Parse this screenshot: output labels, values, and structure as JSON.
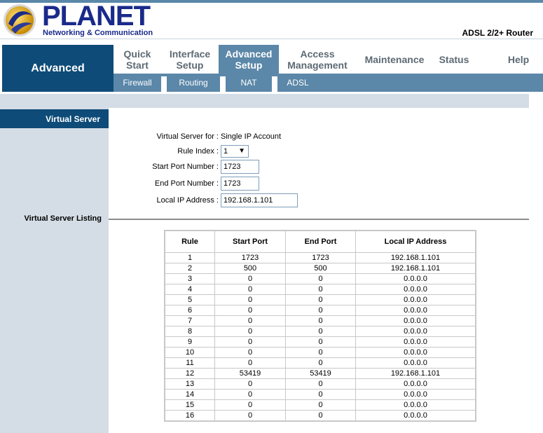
{
  "header": {
    "brand": "PLANET",
    "brand_sub": "Networking & Communication",
    "product": "ADSL 2/2+ Router"
  },
  "section": {
    "title": "Advanced"
  },
  "menu": [
    {
      "line1": "Quick",
      "line2": "Start",
      "active": false
    },
    {
      "line1": "Interface",
      "line2": "Setup",
      "active": false
    },
    {
      "line1": "Advanced",
      "line2": "Setup",
      "active": true
    },
    {
      "line1": "Access",
      "line2": "Management",
      "active": false
    },
    {
      "line1": "Maintenance",
      "line2": "",
      "active": false
    },
    {
      "line1": "Status",
      "line2": "",
      "active": false
    },
    {
      "line1": "Help",
      "line2": "",
      "active": false
    }
  ],
  "submenu": [
    "Firewall",
    "Routing",
    "NAT",
    "ADSL"
  ],
  "left": {
    "virtual_server": "Virtual Server",
    "listing": "Virtual Server Listing"
  },
  "form": {
    "for_label": "Virtual Server for :",
    "for_value": "Single IP Account",
    "rule_index_label": "Rule Index :",
    "rule_index_value": "1",
    "start_port_label": "Start Port Number :",
    "start_port_value": "1723",
    "end_port_label": "End Port Number :",
    "end_port_value": "1723",
    "local_ip_label": "Local IP Address :",
    "local_ip_value": "192.168.1.101"
  },
  "table": {
    "headers": [
      "Rule",
      "Start Port",
      "End Port",
      "Local IP Address"
    ],
    "rows": [
      [
        "1",
        "1723",
        "1723",
        "192.168.1.101"
      ],
      [
        "2",
        "500",
        "500",
        "192.168.1.101"
      ],
      [
        "3",
        "0",
        "0",
        "0.0.0.0"
      ],
      [
        "4",
        "0",
        "0",
        "0.0.0.0"
      ],
      [
        "5",
        "0",
        "0",
        "0.0.0.0"
      ],
      [
        "6",
        "0",
        "0",
        "0.0.0.0"
      ],
      [
        "7",
        "0",
        "0",
        "0.0.0.0"
      ],
      [
        "8",
        "0",
        "0",
        "0.0.0.0"
      ],
      [
        "9",
        "0",
        "0",
        "0.0.0.0"
      ],
      [
        "10",
        "0",
        "0",
        "0.0.0.0"
      ],
      [
        "11",
        "0",
        "0",
        "0.0.0.0"
      ],
      [
        "12",
        "53419",
        "53419",
        "192.168.1.101"
      ],
      [
        "13",
        "0",
        "0",
        "0.0.0.0"
      ],
      [
        "14",
        "0",
        "0",
        "0.0.0.0"
      ],
      [
        "15",
        "0",
        "0",
        "0.0.0.0"
      ],
      [
        "16",
        "0",
        "0",
        "0.0.0.0"
      ]
    ]
  },
  "colors": {
    "nav_dark": "#0e4b78",
    "nav_mid": "#5b87a8",
    "panel": "#d4dde5",
    "brand": "#1a2a8a"
  }
}
